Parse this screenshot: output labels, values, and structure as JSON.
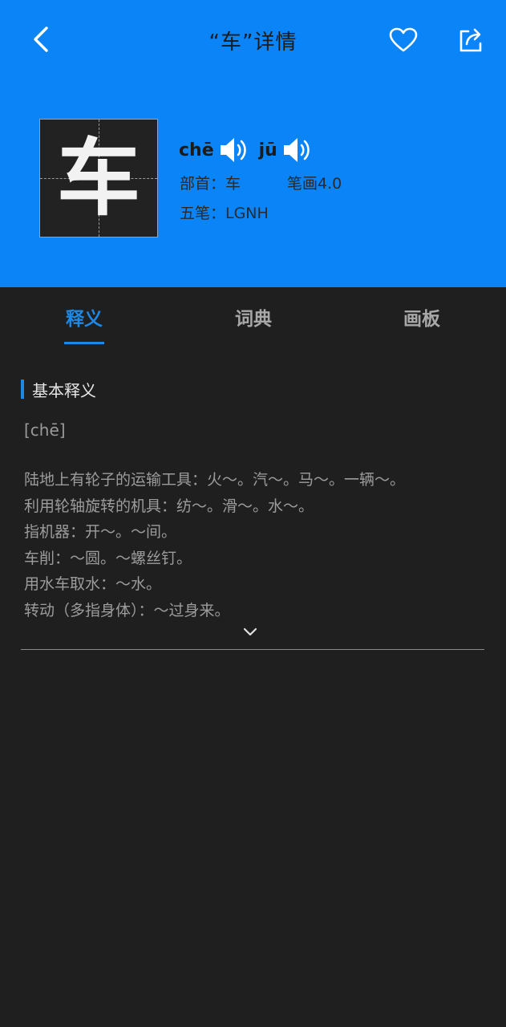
{
  "header": {
    "title": "“车”详情",
    "back_icon": "chevron-left-icon",
    "favorite_icon": "heart-icon",
    "share_icon": "share-icon",
    "background": "#0a84f7"
  },
  "character": {
    "glyph": "车",
    "pinyin": [
      {
        "text": "chē",
        "icon": "speaker-icon"
      },
      {
        "text": "jū",
        "icon": "speaker-icon"
      }
    ],
    "radical": "部首：车",
    "strokes": "笔画4.0",
    "wubi": "五笔：LGNH"
  },
  "tabs": [
    {
      "label": "释义",
      "active": true
    },
    {
      "label": "词典",
      "active": false
    },
    {
      "label": "画板",
      "active": false
    }
  ],
  "accent_color": "#1e88e5",
  "content": {
    "section_title": "基本释义",
    "reading": "[chē]",
    "definitions": [
      "陆地上有轮子的运输工具：火～。汽～。马～。一辆～。",
      "利用轮轴旋转的机具：纺～。滑～。水～。",
      "指机器：开～。～间。",
      "车削：～圆。～螺丝钉。",
      "用水车取水：～水。",
      "转动（多指身体）：～过身来。"
    ],
    "expand_icon": "chevron-down-icon"
  }
}
